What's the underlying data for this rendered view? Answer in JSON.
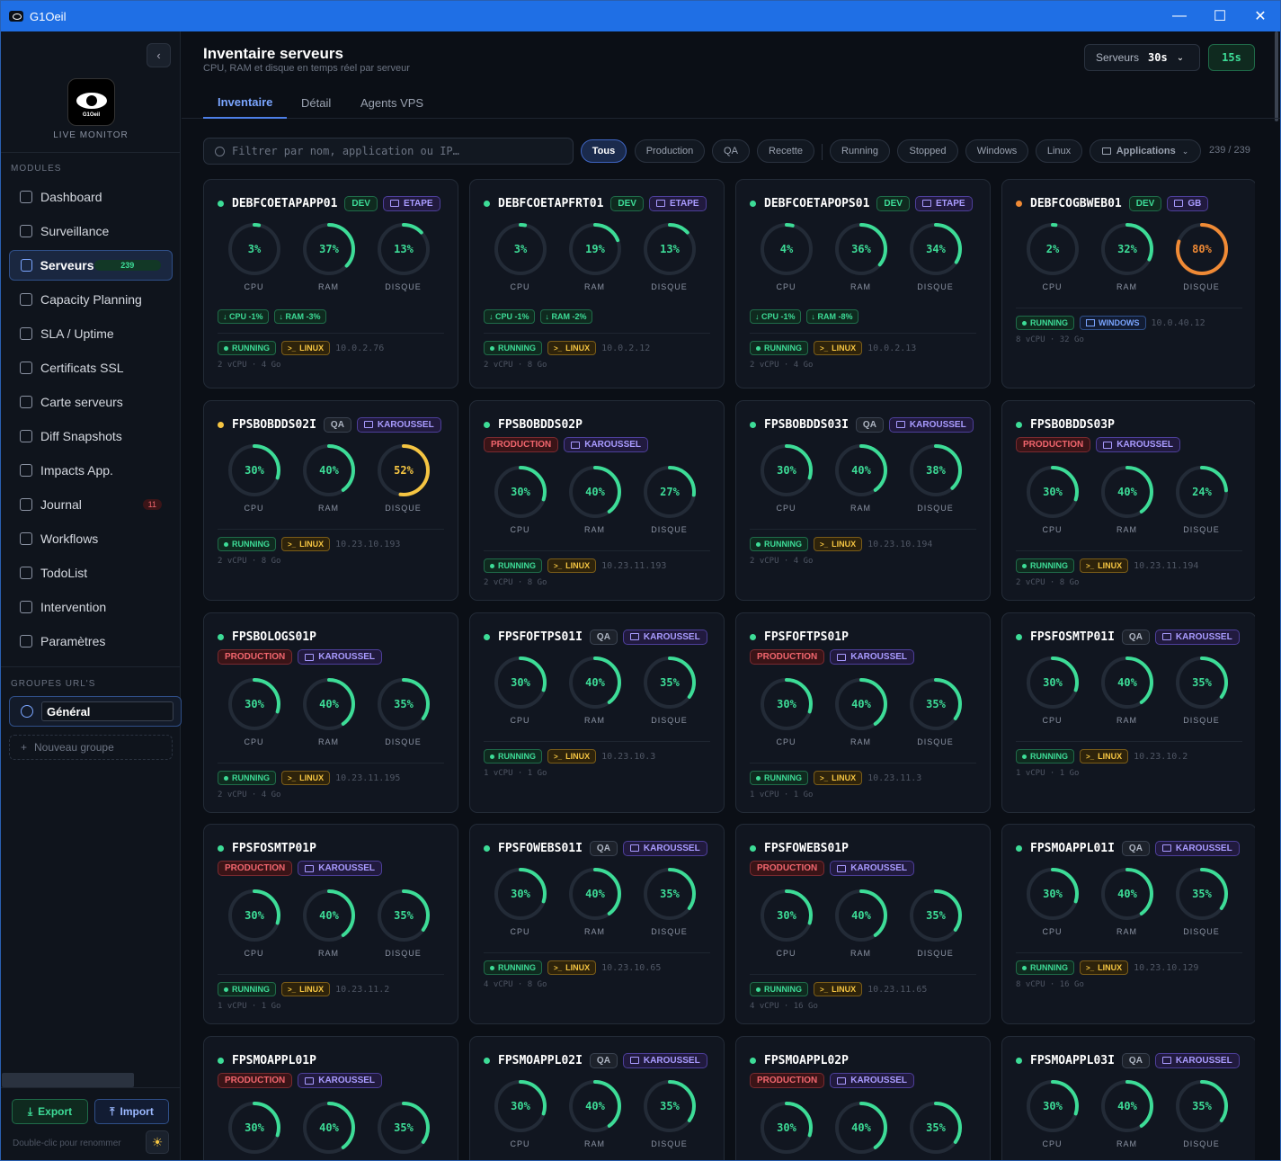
{
  "window": {
    "title": "G1Oeil",
    "minimize": "—",
    "maximize": "☐",
    "close": "✕"
  },
  "sidebar": {
    "collapse_icon": "‹",
    "logo_text": "G1Oeil",
    "brand": "LIVE MONITOR",
    "modules_heading": "MODULES",
    "items": [
      {
        "label": "Dashboard",
        "icon": "grid-icon"
      },
      {
        "label": "Surveillance",
        "icon": "monitor-icon"
      },
      {
        "label": "Serveurs",
        "icon": "server-icon",
        "badge": "239",
        "active": true
      },
      {
        "label": "Capacity Planning",
        "icon": "chart-icon"
      },
      {
        "label": "SLA / Uptime",
        "icon": "pulse-icon"
      },
      {
        "label": "Certificats SSL",
        "icon": "shield-icon"
      },
      {
        "label": "Carte serveurs",
        "icon": "map-icon"
      },
      {
        "label": "Diff Snapshots",
        "icon": "diff-icon"
      },
      {
        "label": "Impacts App.",
        "icon": "network-icon"
      },
      {
        "label": "Journal",
        "icon": "warning-icon",
        "badge": "11"
      },
      {
        "label": "Workflows",
        "icon": "branch-icon"
      },
      {
        "label": "TodoList",
        "icon": "clipboard-icon"
      },
      {
        "label": "Intervention",
        "icon": "wrench-icon"
      },
      {
        "label": "Paramètres",
        "icon": "gear-icon"
      }
    ],
    "groups_heading": "GROUPES URL'S",
    "group_name": "Général",
    "new_group": "Nouveau groupe",
    "export_label": "Export",
    "import_label": "Import",
    "hint": "Double-clic pour renommer",
    "theme_icon": "☀"
  },
  "header": {
    "title": "Inventaire serveurs",
    "subtitle": "CPU, RAM et disque en temps réel par serveur",
    "servers_label": "Serveurs",
    "servers_interval": "30s",
    "refresh": "15s"
  },
  "tabs": [
    "Inventaire",
    "Détail",
    "Agents VPS"
  ],
  "filters": {
    "search_placeholder": "Filtrer par nom, application ou IP…",
    "chips": [
      "Tous",
      "Production",
      "QA",
      "Recette",
      "Running",
      "Stopped",
      "Windows",
      "Linux"
    ],
    "apps_label": "Applications",
    "count": "239 / 239"
  },
  "gauge_labels": {
    "cpu": "CPU",
    "ram": "RAM",
    "disk": "DISQUE"
  },
  "colors": {
    "accent": "#4d7fe8",
    "ok": "#3ddc97",
    "warn": "#f5c542",
    "danger": "#f0656d",
    "orange": "#f08a35"
  },
  "servers": [
    {
      "name": "DEBFCOETAPAPP01",
      "dot": "#3ddc97",
      "env": "DEV",
      "app": "ETAPE",
      "cpu": 3,
      "ram": 37,
      "disk": 13,
      "deltas": [
        "↓ CPU -1%",
        "↓ RAM -3%"
      ],
      "status": "RUNNING",
      "os": "LINUX",
      "ip": "10.0.2.76",
      "spec": "2 vCPU · 4 Go"
    },
    {
      "name": "DEBFCOETAPFRT01",
      "dot": "#3ddc97",
      "env": "DEV",
      "app": "ETAPE",
      "cpu": 3,
      "ram": 19,
      "disk": 13,
      "deltas": [
        "↓ CPU -1%",
        "↓ RAM -2%"
      ],
      "status": "RUNNING",
      "os": "LINUX",
      "ip": "10.0.2.12",
      "spec": "2 vCPU · 8 Go"
    },
    {
      "name": "DEBFCOETAPOPS01",
      "dot": "#3ddc97",
      "env": "DEV",
      "app": "ETAPE",
      "cpu": 4,
      "ram": 36,
      "disk": 34,
      "deltas": [
        "↓ CPU -1%",
        "↓ RAM -8%"
      ],
      "status": "RUNNING",
      "os": "LINUX",
      "ip": "10.0.2.13",
      "spec": "2 vCPU · 4 Go"
    },
    {
      "name": "DEBFCOGBWEB01",
      "dot": "#f08a35",
      "env": "DEV",
      "app": "GB",
      "cpu": 2,
      "ram": 32,
      "disk": 80,
      "deltas": [],
      "status": "RUNNING",
      "os": "WINDOWS",
      "ip": "10.0.40.12",
      "spec": "8 vCPU · 32 Go"
    },
    {
      "name": "FPSBOBDDS02I",
      "dot": "#f5c542",
      "env": "QA",
      "app": "KAROUSSEL",
      "cpu": 30,
      "ram": 40,
      "disk": 52,
      "deltas": [],
      "status": "RUNNING",
      "os": "LINUX",
      "ip": "10.23.10.193",
      "spec": "2 vCPU · 8 Go"
    },
    {
      "name": "FPSBOBDDS02P",
      "dot": "#3ddc97",
      "env": "PRODUCTION",
      "app": "KAROUSSEL",
      "cpu": 30,
      "ram": 40,
      "disk": 27,
      "deltas": [],
      "status": "RUNNING",
      "os": "LINUX",
      "ip": "10.23.11.193",
      "spec": "2 vCPU · 8 Go"
    },
    {
      "name": "FPSBOBDDS03I",
      "dot": "#3ddc97",
      "env": "QA",
      "app": "KAROUSSEL",
      "cpu": 30,
      "ram": 40,
      "disk": 38,
      "deltas": [],
      "status": "RUNNING",
      "os": "LINUX",
      "ip": "10.23.10.194",
      "spec": "2 vCPU · 4 Go"
    },
    {
      "name": "FPSBOBDDS03P",
      "dot": "#3ddc97",
      "env": "PRODUCTION",
      "app": "KAROUSSEL",
      "cpu": 30,
      "ram": 40,
      "disk": 24,
      "deltas": [],
      "status": "RUNNING",
      "os": "LINUX",
      "ip": "10.23.11.194",
      "spec": "2 vCPU · 8 Go"
    },
    {
      "name": "FPSBOLOGS01P",
      "dot": "#3ddc97",
      "env": "PRODUCTION",
      "app": "KAROUSSEL",
      "cpu": 30,
      "ram": 40,
      "disk": 35,
      "deltas": [],
      "status": "RUNNING",
      "os": "LINUX",
      "ip": "10.23.11.195",
      "spec": "2 vCPU · 4 Go"
    },
    {
      "name": "FPSFOFTPS01I",
      "dot": "#3ddc97",
      "env": "QA",
      "app": "KAROUSSEL",
      "cpu": 30,
      "ram": 40,
      "disk": 35,
      "deltas": [],
      "status": "RUNNING",
      "os": "LINUX",
      "ip": "10.23.10.3",
      "spec": "1 vCPU · 1 Go"
    },
    {
      "name": "FPSFOFTPS01P",
      "dot": "#3ddc97",
      "env": "PRODUCTION",
      "app": "KAROUSSEL",
      "cpu": 30,
      "ram": 40,
      "disk": 35,
      "deltas": [],
      "status": "RUNNING",
      "os": "LINUX",
      "ip": "10.23.11.3",
      "spec": "1 vCPU · 1 Go"
    },
    {
      "name": "FPSFOSMTP01I",
      "dot": "#3ddc97",
      "env": "QA",
      "app": "KAROUSSEL",
      "cpu": 30,
      "ram": 40,
      "disk": 35,
      "deltas": [],
      "status": "RUNNING",
      "os": "LINUX",
      "ip": "10.23.10.2",
      "spec": "1 vCPU · 1 Go"
    },
    {
      "name": "FPSFOSMTP01P",
      "dot": "#3ddc97",
      "env": "PRODUCTION",
      "app": "KAROUSSEL",
      "cpu": 30,
      "ram": 40,
      "disk": 35,
      "deltas": [],
      "status": "RUNNING",
      "os": "LINUX",
      "ip": "10.23.11.2",
      "spec": "1 vCPU · 1 Go"
    },
    {
      "name": "FPSFOWEBS01I",
      "dot": "#3ddc97",
      "env": "QA",
      "app": "KAROUSSEL",
      "cpu": 30,
      "ram": 40,
      "disk": 35,
      "deltas": [],
      "status": "RUNNING",
      "os": "LINUX",
      "ip": "10.23.10.65",
      "spec": "4 vCPU · 8 Go"
    },
    {
      "name": "FPSFOWEBS01P",
      "dot": "#3ddc97",
      "env": "PRODUCTION",
      "app": "KAROUSSEL",
      "cpu": 30,
      "ram": 40,
      "disk": 35,
      "deltas": [],
      "status": "RUNNING",
      "os": "LINUX",
      "ip": "10.23.11.65",
      "spec": "4 vCPU · 16 Go"
    },
    {
      "name": "FPSMOAPPL01I",
      "dot": "#3ddc97",
      "env": "QA",
      "app": "KAROUSSEL",
      "cpu": 30,
      "ram": 40,
      "disk": 35,
      "deltas": [],
      "status": "RUNNING",
      "os": "LINUX",
      "ip": "10.23.10.129",
      "spec": "8 vCPU · 16 Go"
    },
    {
      "name": "FPSMOAPPL01P",
      "dot": "#3ddc97",
      "env": "PRODUCTION",
      "app": "KAROUSSEL",
      "cpu": 30,
      "ram": 40,
      "disk": 35,
      "deltas": [],
      "status": "",
      "os": "",
      "ip": "",
      "spec": ""
    },
    {
      "name": "FPSMOAPPL02I",
      "dot": "#3ddc97",
      "env": "QA",
      "app": "KAROUSSEL",
      "cpu": 30,
      "ram": 40,
      "disk": 35,
      "deltas": [],
      "status": "",
      "os": "",
      "ip": "",
      "spec": ""
    },
    {
      "name": "FPSMOAPPL02P",
      "dot": "#3ddc97",
      "env": "PRODUCTION",
      "app": "KAROUSSEL",
      "cpu": 30,
      "ram": 40,
      "disk": 35,
      "deltas": [],
      "status": "",
      "os": "",
      "ip": "",
      "spec": ""
    },
    {
      "name": "FPSMOAPPL03I",
      "dot": "#3ddc97",
      "env": "QA",
      "app": "KAROUSSEL",
      "cpu": 30,
      "ram": 40,
      "disk": 35,
      "deltas": [],
      "status": "",
      "os": "",
      "ip": "",
      "spec": ""
    }
  ]
}
